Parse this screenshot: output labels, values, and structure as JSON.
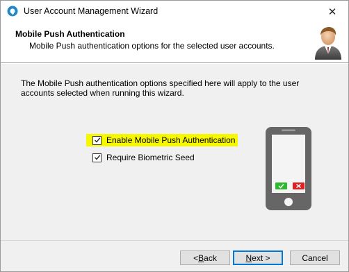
{
  "window": {
    "title": "User Account Management Wizard",
    "close_label": "✕"
  },
  "header": {
    "title": "Mobile Push Authentication",
    "subtitle": "Mobile Push authentication options for the selected user accounts."
  },
  "body": {
    "description": "The Mobile Push authentication options specified here will apply to the user accounts selected when running this wizard.",
    "options": [
      {
        "label": "Enable Mobile Push Authentication",
        "checked": true,
        "highlighted": true,
        "highlight_color": "#f7f700"
      },
      {
        "label": "Require Biometric Seed",
        "checked": true
      }
    ]
  },
  "phone": {
    "accept_icon": "check-icon",
    "reject_icon": "x-icon",
    "accept_color": "#2eb82e",
    "reject_color": "#e02020"
  },
  "buttons": {
    "back_prefix": "< ",
    "back_mnemonic": "B",
    "back_rest": "ack",
    "next_mnemonic": "N",
    "next_rest": "ext >",
    "cancel": "Cancel"
  }
}
